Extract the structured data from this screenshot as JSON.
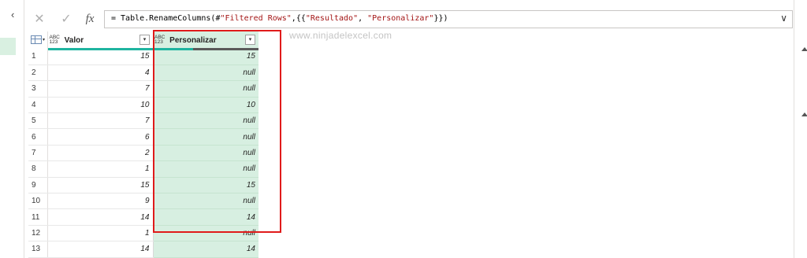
{
  "left_pane": {
    "collapse_glyph": "‹"
  },
  "formula_bar": {
    "cancel_glyph": "✕",
    "commit_glyph": "✓",
    "fx_label": "fx",
    "formula_prefix": "= Table.RenameColumns(#",
    "formula_str1": "\"Filtered Rows\"",
    "formula_mid": ",{{",
    "formula_str2": "\"Resultado\"",
    "formula_comma": ", ",
    "formula_str3": "\"Personalizar\"",
    "formula_suffix": "}})",
    "expand_glyph": "∨"
  },
  "watermark": "www.ninjadelexcel.com",
  "grid": {
    "type_badge_top": "ABC",
    "type_badge_bottom": "123",
    "dropdown_glyph": "▾",
    "columns": [
      {
        "name": "Valor"
      },
      {
        "name": "Personalizar"
      }
    ],
    "rows": [
      {
        "idx": "1",
        "valor": "15",
        "personalizar": "15"
      },
      {
        "idx": "2",
        "valor": "4",
        "personalizar": "null"
      },
      {
        "idx": "3",
        "valor": "7",
        "personalizar": "null"
      },
      {
        "idx": "4",
        "valor": "10",
        "personalizar": "10"
      },
      {
        "idx": "5",
        "valor": "7",
        "personalizar": "null"
      },
      {
        "idx": "6",
        "valor": "6",
        "personalizar": "null"
      },
      {
        "idx": "7",
        "valor": "2",
        "personalizar": "null"
      },
      {
        "idx": "8",
        "valor": "1",
        "personalizar": "null"
      },
      {
        "idx": "9",
        "valor": "15",
        "personalizar": "15"
      },
      {
        "idx": "10",
        "valor": "9",
        "personalizar": "null"
      },
      {
        "idx": "11",
        "valor": "14",
        "personalizar": "14"
      },
      {
        "idx": "12",
        "valor": "1",
        "personalizar": "null"
      },
      {
        "idx": "13",
        "valor": "14",
        "personalizar": "14"
      }
    ],
    "quality": {
      "valor_valid_fraction": 1.0,
      "personalizar_valid_fraction": 0.38
    }
  },
  "colors": {
    "valid": "#1fb4a0",
    "empty": "#5a5a5a",
    "selection": "#d7efe1",
    "highlight": "#e01b1b"
  }
}
